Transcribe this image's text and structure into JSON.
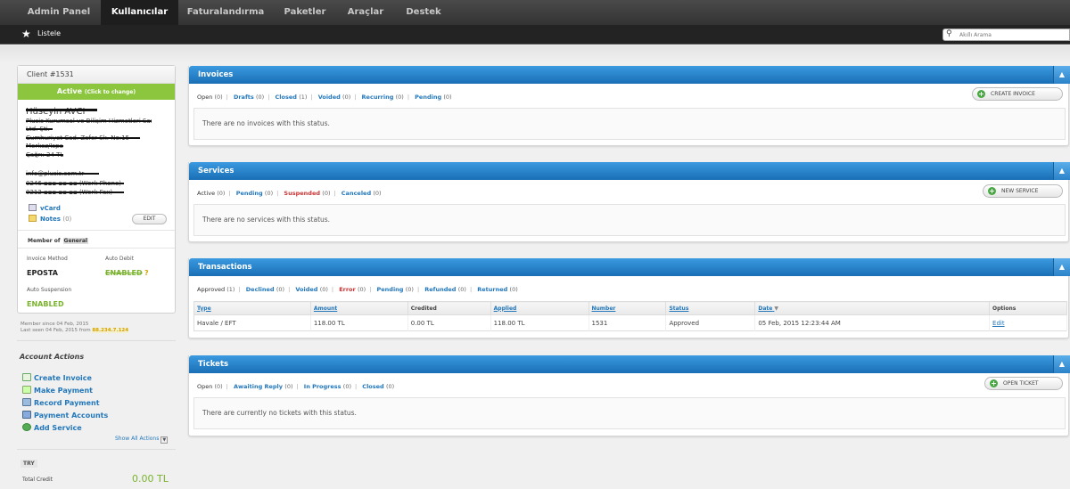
{
  "topnav": [
    "Admin Panel",
    "Kullanıcılar",
    "Faturalandırma",
    "Paketler",
    "Araçlar",
    "Destek"
  ],
  "subnav": {
    "listele": "Listele"
  },
  "search": {
    "placeholder": "Akıllı Arama"
  },
  "client": {
    "title": "Client #1531",
    "status": "Active",
    "status_hint": "(Click to change)",
    "redacted_lines": [
      "Hüseyin AVCI",
      "Plusis Kurumsal ve Bilişim Hizmetleri San. Tic.",
      "Ltd. Şti.",
      "Cumhuriyet Cad. Zafer Sk. No:15",
      "Merkez/Isparta",
      "Çağrı: 24 TL",
      "info@plusis.com.tr",
      "0246 ▪▪▪ ▪▪ ▪▪ (Work Phone)",
      "0212 ▪▪▪ ▪▪ ▪▪ (Work Fax)"
    ],
    "vcard": "vCard",
    "notes": "Notes",
    "notes_count": "(0)",
    "edit": "EDIT",
    "member_of": "Member of",
    "group": "General",
    "invoice_method_label": "Invoice Method",
    "invoice_method": "EPOSTA",
    "auto_debit_label": "Auto Debit",
    "auto_debit": "ENABLED",
    "auto_debit_q": "?",
    "auto_suspension_label": "Auto Suspension",
    "auto_suspension": "ENABLED",
    "member_since": "Member since 04 Feb, 2015",
    "last_seen": "Last seen 04 Feb, 2015 from",
    "last_ip": "88.234.7.124"
  },
  "account_actions": {
    "title": "Account Actions",
    "items": [
      "Create Invoice",
      "Make Payment",
      "Record Payment",
      "Payment Accounts",
      "Add Service"
    ],
    "show_all": "Show All Actions",
    "show_all_icon": "chevron-down"
  },
  "credit": {
    "currency": "TRY",
    "label": "Total Credit",
    "value": "0.00 TL"
  },
  "panels": {
    "invoices": {
      "title": "Invoices",
      "filters": [
        {
          "label": "Open",
          "count": "(0)"
        },
        {
          "label": "Drafts",
          "count": "(0)"
        },
        {
          "label": "Closed",
          "count": "(1)"
        },
        {
          "label": "Voided",
          "count": "(0)"
        },
        {
          "label": "Recurring",
          "count": "(0)"
        },
        {
          "label": "Pending",
          "count": "(0)"
        }
      ],
      "button": "CREATE INVOICE",
      "empty": "There are no invoices with this status."
    },
    "services": {
      "title": "Services",
      "filters": [
        {
          "label": "Active",
          "count": "(0)"
        },
        {
          "label": "Pending",
          "count": "(0)"
        },
        {
          "label": "Suspended",
          "count": "(0)"
        },
        {
          "label": "Canceled",
          "count": "(0)"
        }
      ],
      "button": "NEW SERVICE",
      "empty": "There are no services with this status."
    },
    "transactions": {
      "title": "Transactions",
      "filters": [
        {
          "label": "Approved",
          "count": "(1)"
        },
        {
          "label": "Declined",
          "count": "(0)"
        },
        {
          "label": "Voided",
          "count": "(0)"
        },
        {
          "label": "Error",
          "count": "(0)"
        },
        {
          "label": "Pending",
          "count": "(0)"
        },
        {
          "label": "Refunded",
          "count": "(0)"
        },
        {
          "label": "Returned",
          "count": "(0)"
        }
      ],
      "columns": [
        "Type",
        "Amount",
        "Credited",
        "Applied",
        "Number",
        "Status",
        "Date",
        "Options"
      ],
      "rows": [
        [
          "Havale / EFT",
          "118.00 TL",
          "0.00 TL",
          "118.00 TL",
          "1531",
          "Approved",
          "05 Feb, 2015 12:23:44 AM",
          "Edit"
        ]
      ]
    },
    "tickets": {
      "title": "Tickets",
      "filters": [
        {
          "label": "Open",
          "count": "(0)"
        },
        {
          "label": "Awaiting Reply",
          "count": "(0)"
        },
        {
          "label": "In Progress",
          "count": "(0)"
        },
        {
          "label": "Closed",
          "count": "(0)"
        }
      ],
      "button": "OPEN TICKET",
      "empty": "There are currently no tickets with this status."
    }
  },
  "colors": {
    "panel_header": "#1a6fb5",
    "active_green": "#8cc63f",
    "link": "#2277bb",
    "ip_highlight": "#d3a300"
  }
}
